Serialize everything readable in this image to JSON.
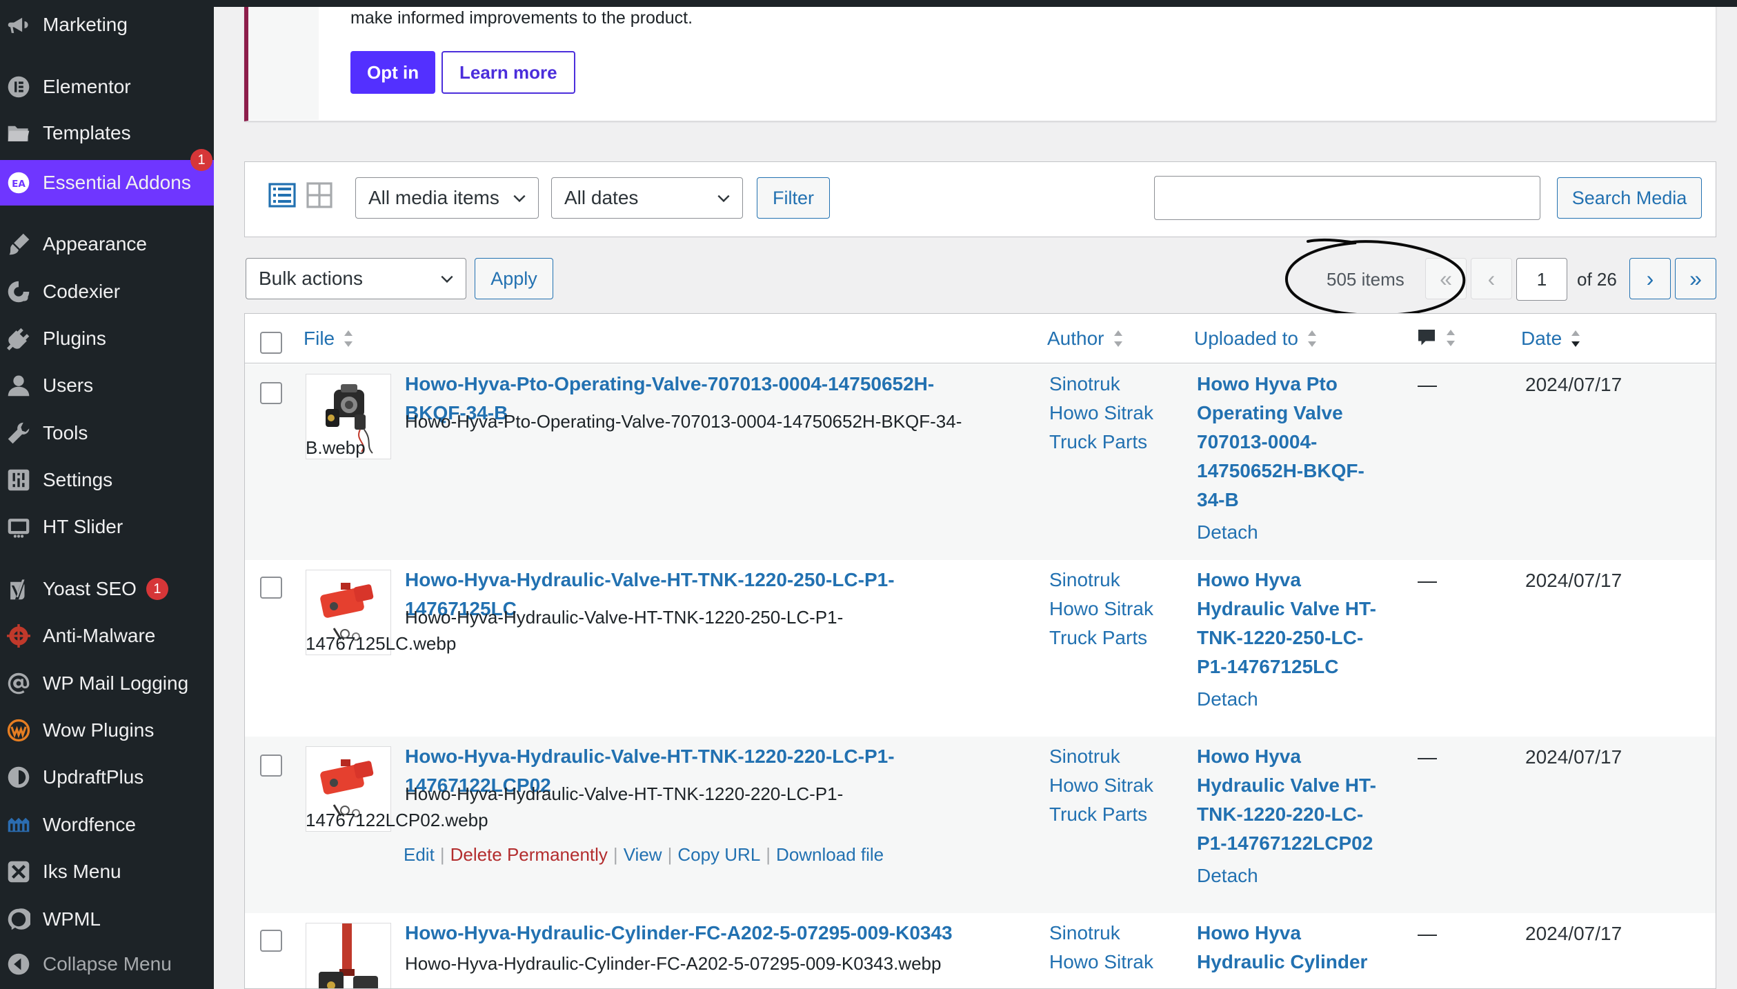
{
  "sidebar": {
    "items": [
      {
        "label": "Marketing",
        "icon": "megaphone-icon"
      },
      {
        "label": "Elementor",
        "icon": "elementor-icon"
      },
      {
        "label": "Templates",
        "icon": "folder-icon"
      },
      {
        "label": "Essential Addons",
        "icon": "essential-addons-icon",
        "badge": "1",
        "active": true
      },
      {
        "label": "Appearance",
        "icon": "paintbrush-icon"
      },
      {
        "label": "Codexier",
        "icon": "codexier-icon"
      },
      {
        "label": "Plugins",
        "icon": "plug-icon"
      },
      {
        "label": "Users",
        "icon": "user-icon"
      },
      {
        "label": "Tools",
        "icon": "wrench-icon"
      },
      {
        "label": "Settings",
        "icon": "settings-icon"
      },
      {
        "label": "HT Slider",
        "icon": "slider-icon"
      },
      {
        "label": "Yoast SEO",
        "icon": "yoast-icon",
        "badge": "1"
      },
      {
        "label": "Anti-Malware",
        "icon": "shield-icon"
      },
      {
        "label": "WP Mail Logging",
        "icon": "at-sign-icon"
      },
      {
        "label": "Wow Plugins",
        "icon": "wow-icon"
      },
      {
        "label": "UpdraftPlus",
        "icon": "updraft-icon"
      },
      {
        "label": "Wordfence",
        "icon": "wordfence-icon"
      },
      {
        "label": "Iks Menu",
        "icon": "iks-menu-icon"
      },
      {
        "label": "WPML",
        "icon": "wpml-icon"
      }
    ],
    "collapse_label": "Collapse Menu",
    "accent_color": "#6f36ff"
  },
  "notice": {
    "text": "make informed improvements to the product.",
    "opt_in_label": "Opt in",
    "learn_more_label": "Learn more"
  },
  "filters": {
    "media_type": "All media items",
    "dates": "All dates",
    "filter_label": "Filter",
    "search_value": "",
    "search_label": "Search Media"
  },
  "tablenav": {
    "bulk_actions": "Bulk actions",
    "apply_label": "Apply",
    "items_count": "505 items",
    "first_page": "«",
    "prev_page": "‹",
    "current_page": "1",
    "of_pages": "of 26",
    "next_page": "›",
    "last_page": "»"
  },
  "columns": {
    "file": "File",
    "author": "Author",
    "uploaded_to": "Uploaded to",
    "comments_icon": "comment-bubble-icon",
    "date": "Date"
  },
  "rows": [
    {
      "title_line1": "Howo-Hyva-Pto-Operating-Valve-707013-0004-14750652H-",
      "title_line2": "BKQF-34-B",
      "filename_line1": "Howo-Hyva-Pto-Operating-Valve-707013-0004-14750652H-BKQF-34-",
      "filename_line2": "B.webp",
      "author_lines": [
        "Sinotruk",
        "Howo Sitrak",
        "Truck Parts"
      ],
      "uploaded_lines": [
        "Howo Hyva Pto",
        "Operating Valve",
        "707013-0004-",
        "14750652H-BKQF-",
        "34-B"
      ],
      "detach": "Detach",
      "comments": "—",
      "date": "2024/07/17"
    },
    {
      "title_line1": "Howo-Hyva-Hydraulic-Valve-HT-TNK-1220-250-LC-P1-",
      "title_line2": "14767125LC",
      "filename_line1": "Howo-Hyva-Hydraulic-Valve-HT-TNK-1220-250-LC-P1-",
      "filename_line2": "14767125LC.webp",
      "author_lines": [
        "Sinotruk",
        "Howo Sitrak",
        "Truck Parts"
      ],
      "uploaded_lines": [
        "Howo Hyva",
        "Hydraulic Valve HT-",
        "TNK-1220-250-LC-",
        "P1-14767125LC"
      ],
      "detach": "Detach",
      "comments": "—",
      "date": "2024/07/17"
    },
    {
      "title_line1": "Howo-Hyva-Hydraulic-Valve-HT-TNK-1220-220-LC-P1-",
      "title_line2": "14767122LCP02",
      "filename_line1": "Howo-Hyva-Hydraulic-Valve-HT-TNK-1220-220-LC-P1-",
      "filename_line2": "14767122LCP02.webp",
      "author_lines": [
        "Sinotruk",
        "Howo Sitrak",
        "Truck Parts"
      ],
      "uploaded_lines": [
        "Howo Hyva",
        "Hydraulic Valve HT-",
        "TNK-1220-220-LC-",
        "P1-14767122LCP02"
      ],
      "detach": "Detach",
      "comments": "—",
      "date": "2024/07/17",
      "actions": {
        "edit": "Edit",
        "delete": "Delete Permanently",
        "view": "View",
        "copy_url": "Copy URL",
        "download": "Download file"
      }
    },
    {
      "title_line1": "Howo-Hyva-Hydraulic-Cylinder-FC-A202-5-07295-009-K0343",
      "filename_line1": "Howo-Hyva-Hydraulic-Cylinder-FC-A202-5-07295-009-K0343.webp",
      "author_lines": [
        "Sinotruk",
        "Howo Sitrak"
      ],
      "uploaded_lines": [
        "Howo Hyva",
        "Hydraulic Cylinder"
      ],
      "comments": "—",
      "date": "2024/07/17"
    }
  ],
  "separator": "|"
}
